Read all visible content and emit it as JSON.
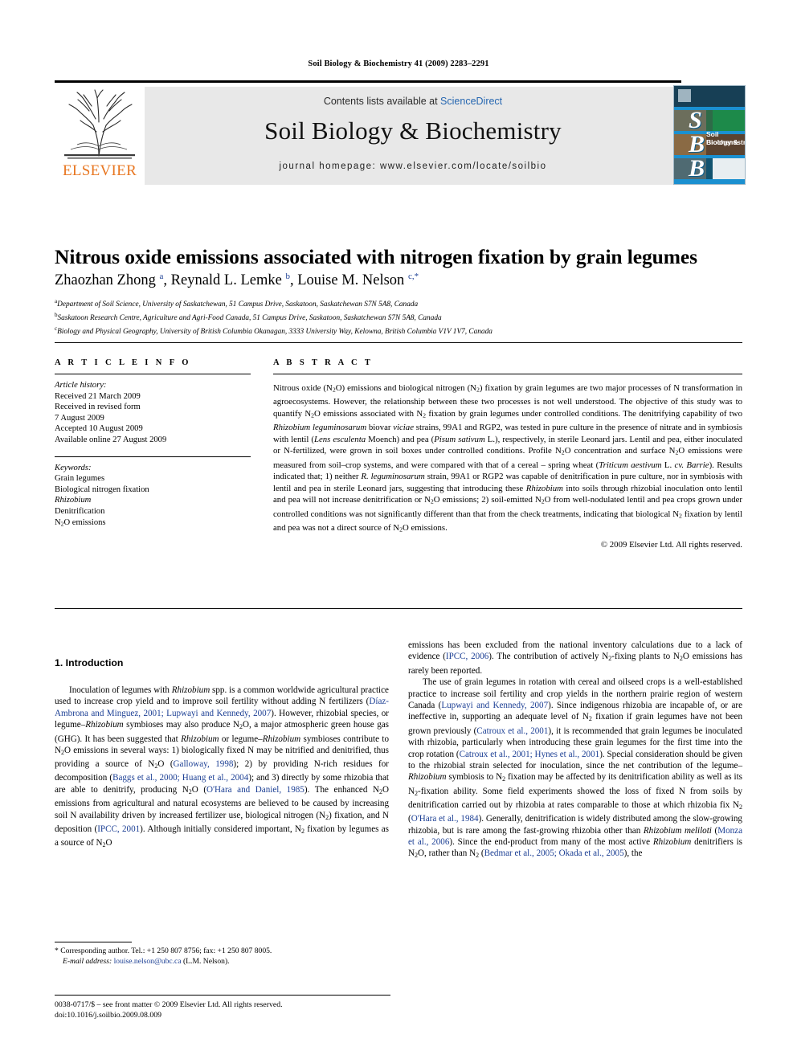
{
  "running_head": "Soil Biology & Biochemistry 41 (2009) 2283–2291",
  "masthead": {
    "contents_prefix": "Contents lists available at ",
    "contents_link": "ScienceDirect",
    "journal_title": "Soil Biology & Biochemistry",
    "homepage": "journal homepage: www.elsevier.com/locate/soilbio",
    "publisher_name": "ELSEVIER",
    "cover_letters": [
      "S",
      "B",
      "B"
    ],
    "cover_title_line1": "Soil Biology &",
    "cover_title_line2": "Biochemistry",
    "accent_orange": "#E87722",
    "link_blue": "#2566b0",
    "cover_blue": "#1b90d0"
  },
  "article": {
    "title": "Nitrous oxide emissions associated with nitrogen fixation by grain legumes",
    "authors_html": "Zhaozhan Zhong <sup>a</sup>, Reynald L. Lemke <sup>b</sup>, Louise M. Nelson <sup>c,</sup><sup>*</sup>",
    "affiliations": [
      "Department of Soil Science, University of Saskatchewan, 51 Campus Drive, Saskatoon, Saskatchewan S7N 5A8, Canada",
      "Saskatoon Research Centre, Agriculture and Agri-Food Canada, 51 Campus Drive, Saskatoon, Saskatchewan S7N 5A8, Canada",
      "Biology and Physical Geography, University of British Columbia Okanagan, 3333 University Way, Kelowna, British Columbia V1V 1V7, Canada"
    ],
    "affiliation_markers": [
      "a",
      "b",
      "c"
    ]
  },
  "article_info": {
    "heading": "A R T I C L E   I N F O",
    "history_label": "Article history:",
    "history": [
      "Received 21 March 2009",
      "Received in revised form",
      "7 August 2009",
      "Accepted 10 August 2009",
      "Available online 27 August 2009"
    ],
    "keywords_label": "Keywords:",
    "keywords_html": [
      "Grain legumes",
      "Biological nitrogen fixation",
      "<em>Rhizobium</em>",
      "Denitrification",
      "N<sub>2</sub>O emissions"
    ]
  },
  "abstract": {
    "heading": "A B S T R A C T",
    "body_html": "Nitrous oxide (N<sub>2</sub>O) emissions and biological nitrogen (N<sub>2</sub>) fixation by grain legumes are two major processes of N transformation in agroecosystems. However, the relationship between these two processes is not well understood. The objective of this study was to quantify N<sub>2</sub>O emissions associated with N<sub>2</sub> fixation by grain legumes under controlled conditions. The denitrifying capability of two <em>Rhizobium leguminosarum</em> biovar <em>viciae</em> strains, 99A1 and RGP2, was tested in pure culture in the presence of nitrate and in symbiosis with lentil (<em>Lens esculenta</em> Moench) and pea (<em>Pisum sativum</em> L.), respectively, in sterile Leonard jars. Lentil and pea, either inoculated or N-fertilized, were grown in soil boxes under controlled conditions. Profile N<sub>2</sub>O concentration and surface N<sub>2</sub>O emissions were measured from soil–crop systems, and were compared with that of a cereal – spring wheat (<em>Triticum aestivum</em> L. <em>cv. Barrie</em>). Results indicated that; 1) neither <em>R. leguminosarum</em> strain, 99A1 or RGP2 was capable of denitrification in pure culture, nor in symbiosis with lentil and pea in sterile Leonard jars, suggesting that introducing these <em>Rhizobium</em> into soils through rhizobial inoculation onto lentil and pea will not increase denitrification or N<sub>2</sub>O emissions; 2) soil-emitted N<sub>2</sub>O from well-nodulated lentil and pea crops grown under controlled conditions was not significantly different than that from the check treatments, indicating that biological N<sub>2</sub> fixation by lentil and pea was not a direct source of N<sub>2</sub>O emissions.",
    "copyright": "© 2009 Elsevier Ltd. All rights reserved."
  },
  "introduction": {
    "heading": "1.  Introduction",
    "left_paragraphs_html": [
      "Inoculation of legumes with <em>Rhizobium</em> spp. is a common worldwide agricultural practice used to increase crop yield and to improve soil fertility without adding N fertilizers (<span class=\"ref\">Díaz-Ambrona and Minguez, 2001; Lupwayi and Kennedy, 2007</span>). However, rhizobial species, or legume–<em>Rhizobium</em> symbioses may also produce N<sub>2</sub>O, a major atmospheric green house gas (GHG). It has been suggested that <em>Rhizobium</em> or legume–<em>Rhizobium</em> symbioses contribute to N<sub>2</sub>O emissions in several ways: 1) biologically fixed N may be nitrified and denitrified, thus providing a source of N<sub>2</sub>O (<span class=\"ref\">Galloway, 1998</span>); 2) by providing N-rich residues for decomposition (<span class=\"ref\">Baggs et al., 2000; Huang et al., 2004</span>); and 3) directly by some rhizobia that are able to denitrify, producing N<sub>2</sub>O (<span class=\"ref\">O'Hara and Daniel, 1985</span>). The enhanced N<sub>2</sub>O emissions from agricultural and natural ecosystems are believed to be caused by increasing soil N availability driven by increased fertilizer use, biological nitrogen (N<sub>2</sub>) fixation, and N deposition (<span class=\"ref\">IPCC, 2001</span>). Although initially considered important, N<sub>2</sub> fixation by legumes as a source of N<sub>2</sub>O"
    ],
    "right_paragraphs_html": [
      "emissions has been excluded from the national inventory calculations due to a lack of evidence (<span class=\"ref\">IPCC, 2006</span>). The contribution of actively N<sub>2</sub>-fixing plants to N<sub>2</sub>O emissions has rarely been reported.",
      "The use of grain legumes in rotation with cereal and oilseed crops is a well-established practice to increase soil fertility and crop yields in the northern prairie region of western Canada (<span class=\"ref\">Lupwayi and Kennedy, 2007</span>). Since indigenous rhizobia are incapable of, or are ineffective in, supporting an adequate level of N<sub>2</sub> fixation if grain legumes have not been grown previously (<span class=\"ref\">Catroux et al., 2001</span>), it is recommended that grain legumes be inoculated with rhizobia, particularly when introducing these grain legumes for the first time into the crop rotation (<span class=\"ref\">Catroux et al., 2001; Hynes et al., 2001</span>). Special consideration should be given to the rhizobial strain selected for inoculation, since the net contribution of the legume–<em>Rhizobium</em> symbiosis to N<sub>2</sub> fixation may be affected by its denitrification ability as well as its N<sub>2</sub>-fixation ability. Some field experiments showed the loss of fixed N from soils by denitrification carried out by rhizobia at rates comparable to those at which rhizobia fix N<sub>2</sub> (<span class=\"ref\">O'Hara et al., 1984</span>). Generally, denitrification is widely distributed among the slow-growing rhizobia, but is rare among the fast-growing rhizobia other than <em>Rhizobium meliloti</em> (<span class=\"ref\">Monza et al., 2006</span>). Since the end-product from many of the most active <em>Rhizobium</em> denitrifiers is N<sub>2</sub>O, rather than N<sub>2</sub> (<span class=\"ref\">Bedmar et al., 2005; Okada et al., 2005</span>), the"
    ]
  },
  "footnote": {
    "corresponding_html": "* Corresponding author. Tel.: +1 250 807 8756; fax: +1 250 807 8005.",
    "email_label": "E-mail address:",
    "email_address": "louise.nelson@ubc.ca",
    "email_owner": "(L.M. Nelson)."
  },
  "page_footer": {
    "line1_html": "0038-0717/$ – see front matter © 2009 Elsevier Ltd. All rights reserved.",
    "line2_html": "doi:10.1016/j.soilbio.2009.08.009"
  }
}
